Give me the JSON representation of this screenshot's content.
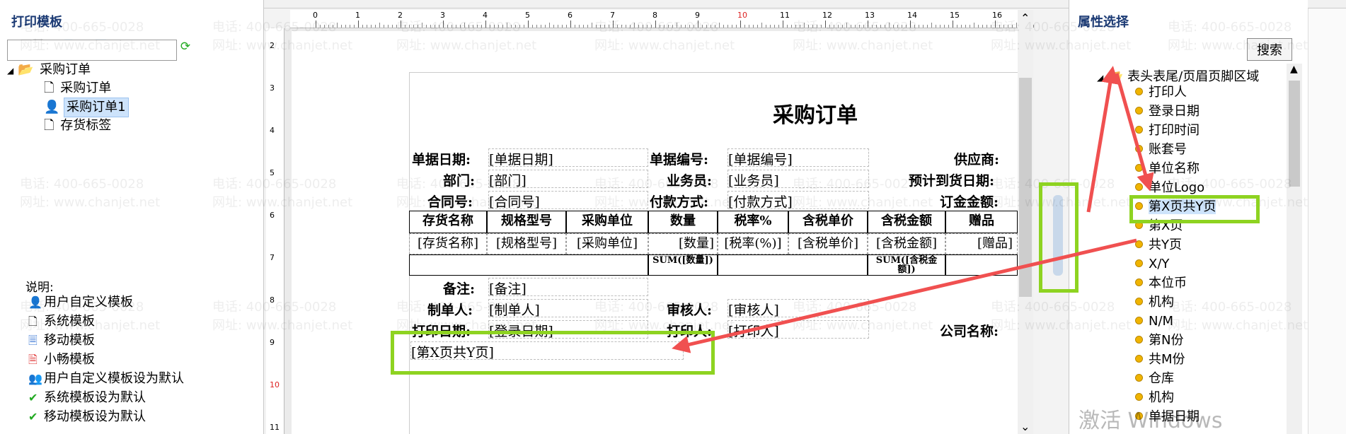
{
  "left_panel": {
    "title": "打印模板",
    "tree": [
      {
        "label": "采购订单"
      },
      {
        "label": "采购订单"
      },
      {
        "label": "采购订单1",
        "selected": true
      },
      {
        "label": "存货标签"
      }
    ],
    "legend_title": "说明:",
    "legend": [
      {
        "label": "用户自定义模板"
      },
      {
        "label": "系统模板"
      },
      {
        "label": "移动模板"
      },
      {
        "label": "小畅模板"
      },
      {
        "label": "用户自定义模板设为默认"
      },
      {
        "label": "系统模板设为默认"
      },
      {
        "label": "移动模板设为默认"
      }
    ]
  },
  "ruler": {
    "top_ticks": [
      "0",
      "1",
      "2",
      "3",
      "4",
      "5",
      "6",
      "7",
      "8",
      "9",
      "10",
      "11",
      "12",
      "13",
      "14",
      "15",
      "16"
    ],
    "left_ticks": [
      "2",
      "3",
      "4",
      "5",
      "6",
      "7",
      "8",
      "9",
      "10",
      "11"
    ]
  },
  "document": {
    "title": "采购订单",
    "rows": [
      {
        "label": "单据日期:",
        "value": "[单据日期]",
        "label2": "单据编号:",
        "value2": "[单据编号]",
        "label3": "供应商:"
      },
      {
        "label": "部门:",
        "value": "[部门]",
        "label2": "业务员:",
        "value2": "[业务员]",
        "label3": "预计到货日期:"
      },
      {
        "label": "合同号:",
        "value": "[合同号]",
        "label2": "付款方式:",
        "value2": "[付款方式]",
        "label3": "订金金额:"
      }
    ],
    "table": {
      "headers": [
        "存货名称",
        "规格型号",
        "采购单位",
        "数量",
        "税率%",
        "含税单价",
        "含税金额",
        "赠品"
      ],
      "fields": [
        "[存货名称]",
        "[规格型号]",
        "[采购单位]",
        "[数量]",
        "[税率(%)]",
        "[含税单价]",
        "[含税金额]",
        "[赠品]"
      ],
      "sum_qty": "SUM([数量])",
      "sum_amount": "SUM([含税金额])"
    },
    "remark_label": "备注:",
    "remark_value": "[备注]",
    "maker_label": "制单人:",
    "maker_value": "[制单人]",
    "reviewer_label": "审核人:",
    "reviewer_value": "[审核人]",
    "print_date_label": "打印日期:",
    "print_date_value": "[登录日期]",
    "printer_label": "打印人:",
    "printer_value": "[打印人]",
    "company_label": "公司名称:",
    "page_field": "[第X页共Y页]"
  },
  "right_panel": {
    "title": "属性选择",
    "search_button": "搜索",
    "search_value": "",
    "group": "表头表尾/页眉页脚区域",
    "items": [
      "打印人",
      "登录日期",
      "打印时间",
      "账套号",
      "单位名称",
      "单位Logo",
      "第X页共Y页",
      "第X页",
      "共Y页",
      "X/Y",
      "本位币",
      "机构",
      "N/M",
      "第N份",
      "共M份",
      "仓库",
      "机构",
      "单据日期"
    ],
    "highlighted_index": 6
  },
  "watermark": {
    "phone": "电话: 400-665-0028",
    "site": "网址: www.chanjet.net"
  },
  "os_watermark": "激活 Windows",
  "colors": {
    "highlight": "#8ed321",
    "arrow": "#f05050",
    "panel_title": "#1b3a74"
  }
}
